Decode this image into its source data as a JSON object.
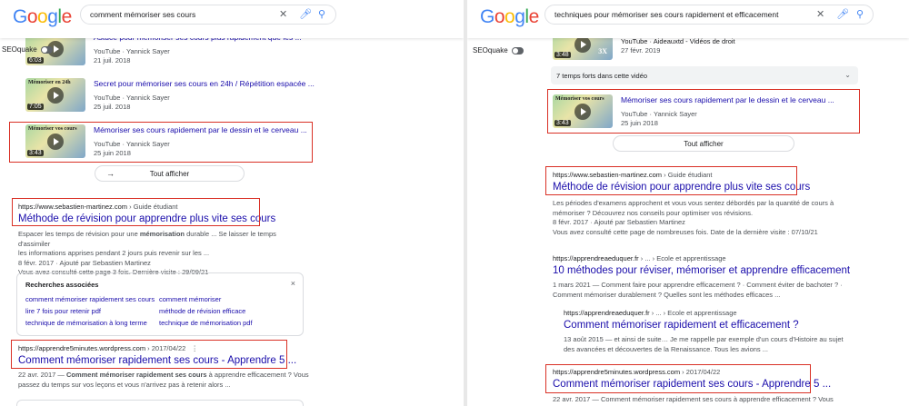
{
  "left": {
    "logo": "Google",
    "query": "comment mémoriser ses cours",
    "seoquake": "SEOquake",
    "videos": [
      {
        "title": "Astuce pour mémoriser ses cours plus rapidement que les ...",
        "source": "YouTube · Yannick Sayer",
        "date": "21 juil. 2018",
        "duration": "6:03",
        "caption": ""
      },
      {
        "title": "Secret pour mémoriser ses cours en 24h / Répétition espacée ...",
        "source": "YouTube · Yannick Sayer",
        "date": "25 juil. 2018",
        "duration": "7:05",
        "caption": "Mémoriser en 24h"
      },
      {
        "title": "Mémoriser ses cours rapidement par le dessin et le cerveau ...",
        "source": "YouTube · Yannick Sayer",
        "date": "25 juin 2018",
        "duration": "3:43",
        "caption": "Mémoriser vos cours"
      }
    ],
    "show_all": "Tout afficher",
    "result1": {
      "url": "https://www.sebastien-martinez.com",
      "breadcrumb": " › Guide étudiant",
      "title": "Méthode de révision pour apprendre plus vite ses cours",
      "snippet_a": "Espacer les temps de révision pour une ",
      "snippet_b": "mémorisation",
      "snippet_c": " durable ... Se laisser le temps d'assimiler",
      "snippet_line2": "les informations apprises pendant 2 jours puis revenir sur les ...",
      "meta": "8 févr. 2017 · Ajouté par Sebastien Martinez",
      "visited": "Vous avez consulté cette page 3 fois. Dernière visite : 29/09/21"
    },
    "related": {
      "heading": "Recherches associées",
      "close": "×",
      "col1": [
        "comment mémoriser rapidement ses cours",
        "lire 7 fois pour retenir pdf",
        "technique de mémorisation à long terme"
      ],
      "col2": [
        "comment mémoriser",
        "méthode de révision efficace",
        "technique de mémorisation pdf"
      ]
    },
    "result2": {
      "url": "https://apprendre5minutes.wordpress.com",
      "breadcrumb": " › 2017/04/22",
      "more": "⋮",
      "title": "Comment mémoriser rapidement ses cours - Apprendre 5 ...",
      "snippet_date": "22 avr. 2017 — ",
      "snippet_bold": "Comment mémoriser rapidement ses cours",
      "snippet_rest": " à apprendre efficacement ? Vous",
      "snippet_line2": "passez du temps sur vos leçons et vous n'arrivez pas à retenir alors ..."
    }
  },
  "right": {
    "logo": "Google",
    "query": "techniques pour mémoriser ses cours rapidement et efficacement",
    "seoquake": "SEOquake",
    "video_top": {
      "source": "YouTube · Aideauxtd - Vidéos de droit",
      "date": "27 févr. 2019",
      "duration": "3:48",
      "caption": "3X"
    },
    "moments": "7 temps forts dans cette vidéo",
    "video_main": {
      "title": "Mémoriser ses cours rapidement par le dessin et le cerveau ...",
      "source": "YouTube · Yannick Sayer",
      "date": "25 juin 2018",
      "duration": "3:43",
      "caption": "Mémoriser vos cours"
    },
    "show_all": "Tout afficher",
    "result1": {
      "url": "https://www.sebastien-martinez.com",
      "breadcrumb": " › Guide étudiant",
      "title": "Méthode de révision pour apprendre plus vite ses cours",
      "snippet_line1": "Les périodes d'examens approchent et vous vous sentez débordés par la quantité de cours à",
      "snippet_line2": "mémoriser ? Découvrez nos conseils pour optimiser vos révisions.",
      "meta": "8 févr. 2017 · Ajouté par Sebastien Martinez",
      "visited": "Vous avez consulté cette page de nombreuses fois. Date de la dernière visite : 07/10/21"
    },
    "result2": {
      "url": "https://apprendreaeduquer.fr",
      "breadcrumb": " › ... › Ecole et apprentissage",
      "title": "10 méthodes pour réviser, mémoriser et apprendre efficacement",
      "snippet_line1": "1 mars 2021 — Comment faire pour apprendre efficacement ? · Comment éviter de bachoter ? ·",
      "snippet_line2": "Comment mémoriser durablement ? Quelles sont les méthodes efficaces ..."
    },
    "result3": {
      "url": "https://apprendreaeduquer.fr",
      "breadcrumb": " › ... › Ecole et apprentissage",
      "title": "Comment mémoriser rapidement et efficacement ?",
      "snippet_line1": "13 août 2015 — et ainsi de suite… Je me rappelle par exemple d'un cours d'Histoire au sujet",
      "snippet_line2": "des avancées et découvertes de la Renaissance. Tous les avions ..."
    },
    "result4": {
      "url": "https://apprendre5minutes.wordpress.com",
      "breadcrumb": " › 2017/04/22",
      "title": "Comment mémoriser rapidement ses cours - Apprendre 5 ...",
      "snippet_line1": "22 avr. 2017 — Comment mémoriser rapidement ses cours à apprendre efficacement ? Vous"
    }
  },
  "colors": {
    "link": "#1a0dab",
    "highlight_box": "#d93025",
    "text": "#202124",
    "muted": "#4d5156"
  }
}
